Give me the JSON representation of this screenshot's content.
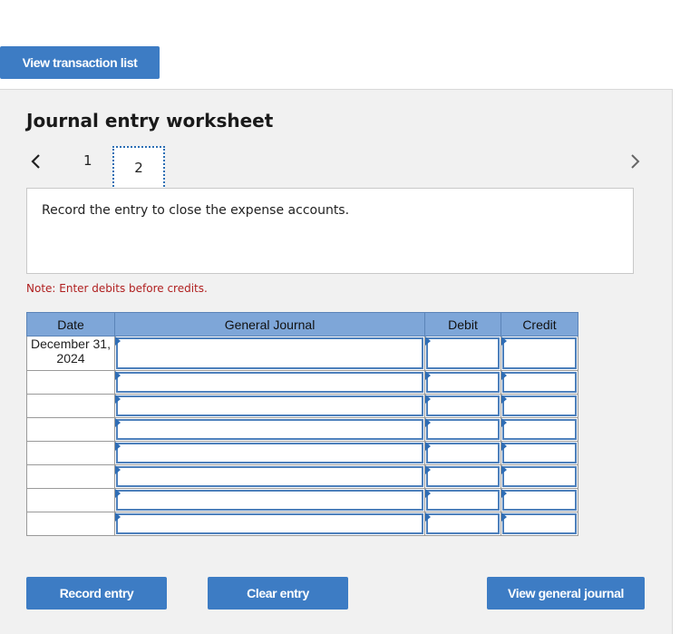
{
  "header": {
    "view_transactions_label": "View transaction list"
  },
  "worksheet": {
    "title": "Journal entry worksheet",
    "pages": [
      "1",
      "2"
    ],
    "current_page": "2",
    "instruction": "Record the entry to close the expense accounts.",
    "note": "Note: Enter debits before credits."
  },
  "table": {
    "columns": {
      "date": "Date",
      "account": "General Journal",
      "debit": "Debit",
      "credit": "Credit"
    },
    "rows": [
      {
        "date": "December 31, 2024",
        "account": "",
        "debit": "",
        "credit": ""
      },
      {
        "date": "",
        "account": "",
        "debit": "",
        "credit": ""
      },
      {
        "date": "",
        "account": "",
        "debit": "",
        "credit": ""
      },
      {
        "date": "",
        "account": "",
        "debit": "",
        "credit": ""
      },
      {
        "date": "",
        "account": "",
        "debit": "",
        "credit": ""
      },
      {
        "date": "",
        "account": "",
        "debit": "",
        "credit": ""
      },
      {
        "date": "",
        "account": "",
        "debit": "",
        "credit": ""
      },
      {
        "date": "",
        "account": "",
        "debit": "",
        "credit": ""
      }
    ]
  },
  "actions": {
    "record": "Record entry",
    "clear": "Clear entry",
    "view_journal": "View general journal"
  },
  "colors": {
    "accent": "#3d7cc4",
    "header": "#7ea6d8",
    "note": "#b02020"
  },
  "icons": {
    "prev": "chevron-left-icon",
    "next": "chevron-right-icon"
  }
}
